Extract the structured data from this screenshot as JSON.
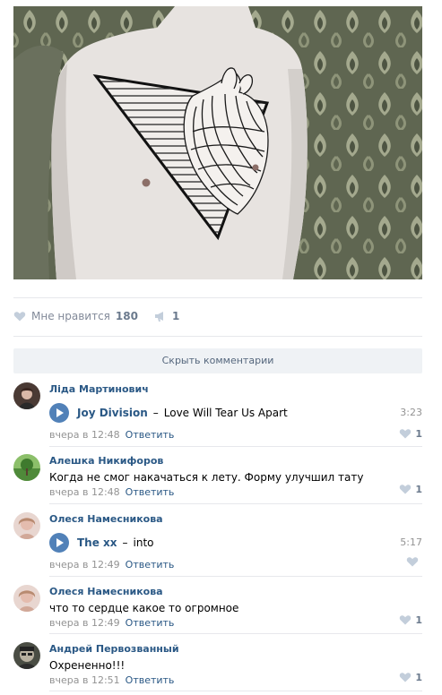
{
  "post": {
    "likes_label": "Мне нравится",
    "likes_count": "180",
    "shares_count": "1",
    "hide_comments_label": "Скрыть комментарии"
  },
  "comments": [
    {
      "author": "Ліда Мартинович",
      "audio": {
        "artist": "Joy Division",
        "title": "Love Will Tear Us Apart",
        "duration": "3:23"
      },
      "time": "вчера в 12:48",
      "reply": "Ответить",
      "likes": "1"
    },
    {
      "author": "Алешка Никифоров",
      "text": "Когда не смог накачаться к лету. Форму улучшил тату",
      "time": "вчера в 12:48",
      "reply": "Ответить",
      "likes": "1"
    },
    {
      "author": "Олеся Намесникова",
      "audio": {
        "artist": "The xx",
        "title": "into",
        "duration": "5:17"
      },
      "time": "вчера в 12:49",
      "reply": "Ответить",
      "likes": ""
    },
    {
      "author": "Олеся Намесникова",
      "text": "что то сердце какое то огромное",
      "time": "вчера в 12:49",
      "reply": "Ответить",
      "likes": "1"
    },
    {
      "author": "Андрей Первозванный",
      "text": "Охрененно!!!",
      "time": "вчера в 12:51",
      "reply": "Ответить",
      "likes": "1"
    }
  ],
  "colors": {
    "link": "#2a5885",
    "play": "#5181b8",
    "muted": "#939393"
  }
}
